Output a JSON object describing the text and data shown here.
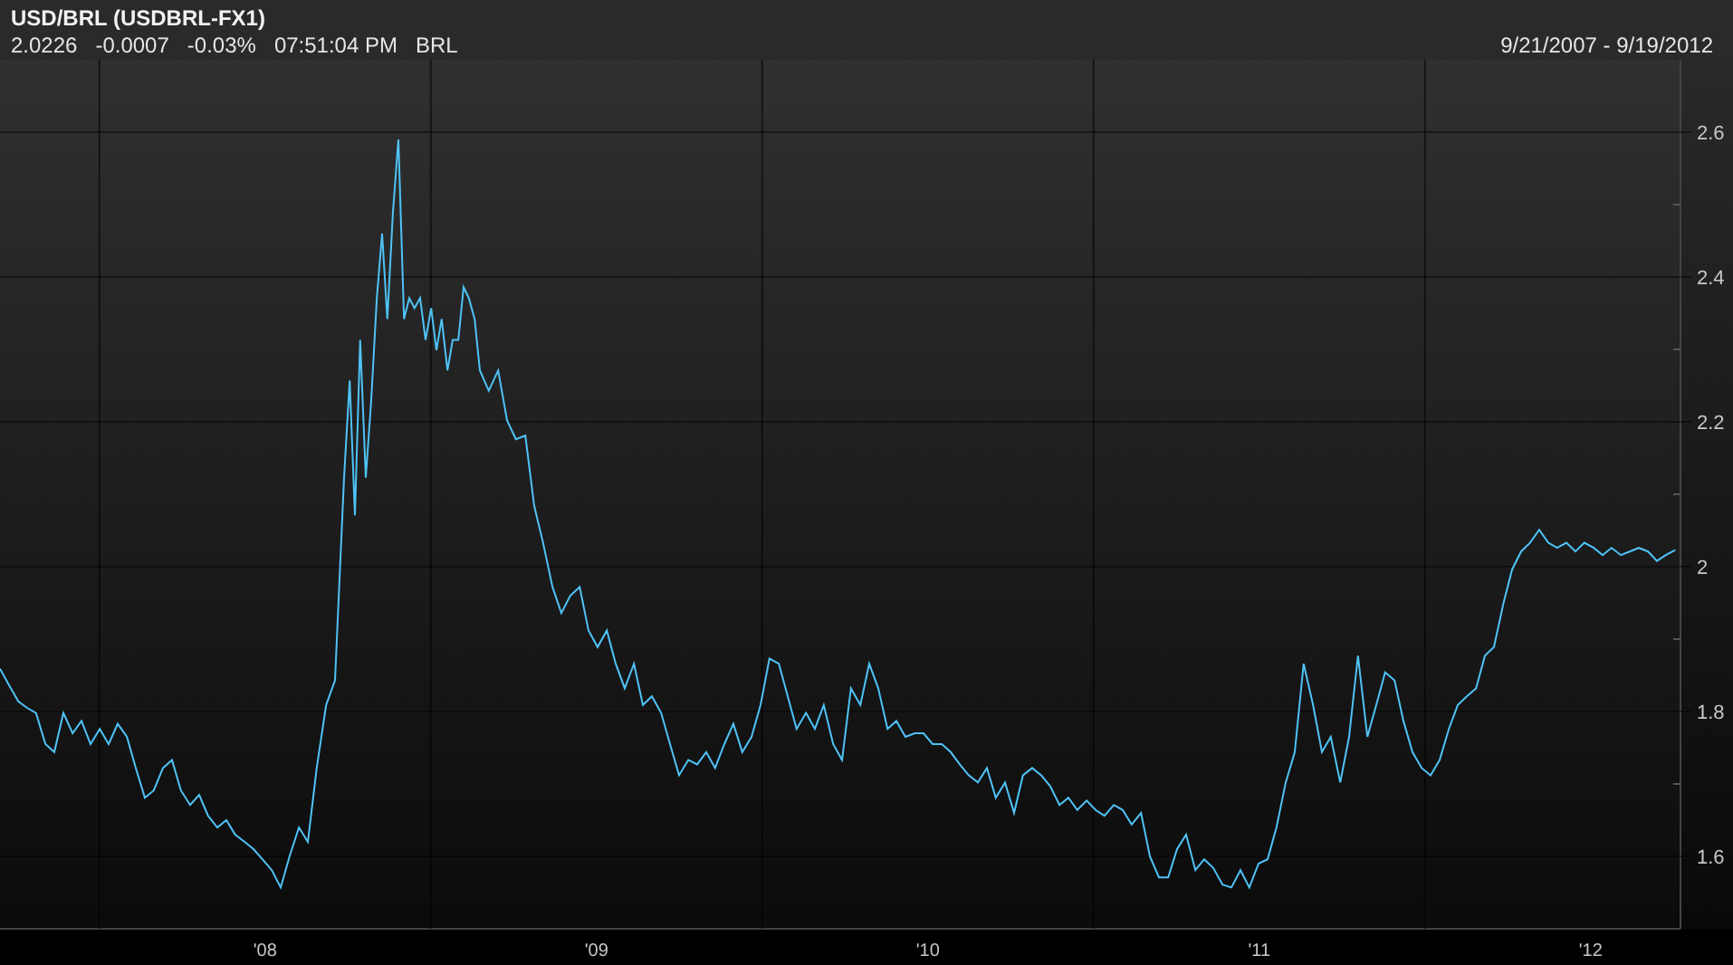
{
  "header": {
    "title": "USD/BRL (USDBRL-FX1)",
    "quote": {
      "price": "2.0226",
      "change": "-0.0007",
      "change_percent": "-0.03%",
      "time": "07:51:04 PM",
      "currency": "BRL"
    },
    "date_range": "9/21/2007 - 9/19/2012"
  },
  "chart": {
    "chart_data": {
      "type": "line",
      "x": [
        7.2,
        7.227,
        7.255,
        7.282,
        7.309,
        7.337,
        7.364,
        7.391,
        7.419,
        7.446,
        7.473,
        7.501,
        7.528,
        7.555,
        7.583,
        7.61,
        7.637,
        7.664,
        7.692,
        7.719,
        7.746,
        7.774,
        7.801,
        7.828,
        7.856,
        7.883,
        7.91,
        7.938,
        7.965,
        7.992,
        8.02,
        8.047,
        8.074,
        8.102,
        8.129,
        8.156,
        8.184,
        8.211,
        8.238,
        8.255,
        8.271,
        8.287,
        8.304,
        8.32,
        8.337,
        8.353,
        8.369,
        8.386,
        8.402,
        8.419,
        8.435,
        8.451,
        8.468,
        8.484,
        8.501,
        8.517,
        8.533,
        8.55,
        8.566,
        8.583,
        8.599,
        8.615,
        8.632,
        8.648,
        8.675,
        8.703,
        8.73,
        8.757,
        8.785,
        8.812,
        8.839,
        8.867,
        8.894,
        8.921,
        8.949,
        8.976,
        9.003,
        9.031,
        9.058,
        9.085,
        9.113,
        9.14,
        9.167,
        9.195,
        9.222,
        9.249,
        9.277,
        9.304,
        9.331,
        9.358,
        9.386,
        9.413,
        9.44,
        9.468,
        9.495,
        9.522,
        9.55,
        9.577,
        9.604,
        9.632,
        9.659,
        9.686,
        9.714,
        9.741,
        9.768,
        9.796,
        9.823,
        9.85,
        9.878,
        9.905,
        9.932,
        9.96,
        9.987,
        10.014,
        10.042,
        10.069,
        10.096,
        10.123,
        10.151,
        10.178,
        10.205,
        10.233,
        10.26,
        10.287,
        10.315,
        10.342,
        10.369,
        10.397,
        10.424,
        10.451,
        10.479,
        10.506,
        10.533,
        10.561,
        10.588,
        10.615,
        10.643,
        10.67,
        10.697,
        10.725,
        10.752,
        10.779,
        10.807,
        10.834,
        10.861,
        10.889,
        10.916,
        10.943,
        10.97,
        10.998,
        11.025,
        11.052,
        11.08,
        11.107,
        11.134,
        11.162,
        11.189,
        11.216,
        11.244,
        11.271,
        11.298,
        11.326,
        11.353,
        11.38,
        11.408,
        11.435,
        11.462,
        11.49,
        11.517,
        11.544,
        11.572,
        11.599,
        11.626,
        11.654,
        11.681,
        11.708,
        11.736,
        11.763,
        11.79,
        11.817,
        11.845,
        11.872,
        11.899,
        11.927,
        11.954,
        11.981,
        12.009,
        12.036,
        12.063,
        12.091,
        12.118,
        12.145,
        12.173,
        12.2,
        12.227,
        12.255
      ],
      "series": [
        {
          "color": "#4fc3f7",
          "values": [
            1.859,
            1.837,
            1.814,
            1.805,
            1.798,
            1.755,
            1.744,
            1.798,
            1.77,
            1.787,
            1.755,
            1.776,
            1.755,
            1.783,
            1.765,
            1.722,
            1.681,
            1.691,
            1.722,
            1.733,
            1.691,
            1.671,
            1.685,
            1.656,
            1.64,
            1.65,
            1.63,
            1.62,
            1.61,
            1.596,
            1.581,
            1.557,
            1.6,
            1.64,
            1.62,
            1.722,
            1.809,
            1.843,
            2.123,
            2.257,
            2.071,
            2.313,
            2.123,
            2.23,
            2.371,
            2.46,
            2.342,
            2.49,
            2.59,
            2.342,
            2.371,
            2.357,
            2.371,
            2.313,
            2.357,
            2.299,
            2.342,
            2.271,
            2.313,
            2.313,
            2.386,
            2.371,
            2.342,
            2.271,
            2.243,
            2.271,
            2.202,
            2.176,
            2.181,
            2.084,
            2.033,
            1.972,
            1.936,
            1.96,
            1.972,
            1.912,
            1.889,
            1.912,
            1.866,
            1.832,
            1.866,
            1.809,
            1.821,
            1.798,
            1.755,
            1.712,
            1.733,
            1.727,
            1.744,
            1.722,
            1.755,
            1.783,
            1.744,
            1.765,
            1.809,
            1.873,
            1.866,
            1.821,
            1.776,
            1.798,
            1.776,
            1.809,
            1.755,
            1.733,
            1.832,
            1.809,
            1.866,
            1.832,
            1.776,
            1.787,
            1.765,
            1.77,
            1.77,
            1.755,
            1.755,
            1.744,
            1.727,
            1.712,
            1.702,
            1.722,
            1.681,
            1.702,
            1.66,
            1.712,
            1.722,
            1.712,
            1.697,
            1.671,
            1.681,
            1.664,
            1.677,
            1.664,
            1.656,
            1.671,
            1.664,
            1.644,
            1.66,
            1.6,
            1.571,
            1.571,
            1.61,
            1.63,
            1.581,
            1.596,
            1.584,
            1.561,
            1.557,
            1.581,
            1.557,
            1.59,
            1.596,
            1.64,
            1.702,
            1.744,
            1.866,
            1.809,
            1.744,
            1.765,
            1.702,
            1.765,
            1.877,
            1.765,
            1.809,
            1.854,
            1.843,
            1.787,
            1.744,
            1.722,
            1.712,
            1.733,
            1.776,
            1.809,
            1.821,
            1.832,
            1.877,
            1.889,
            1.948,
            1.996,
            2.021,
            2.033,
            2.051,
            2.033,
            2.026,
            2.033,
            2.021,
            2.033,
            2.026,
            2.016,
            2.026,
            2.016,
            2.021,
            2.026,
            2.021,
            2.008,
            2.016,
            2.023
          ]
        }
      ],
      "xlim": [
        7.2,
        12.271
      ],
      "ylim": [
        1.5,
        2.7
      ],
      "grid": true,
      "xticks": [
        {
          "value": 8,
          "label": "'08"
        },
        {
          "value": 9,
          "label": "'09"
        },
        {
          "value": 10,
          "label": "'10"
        },
        {
          "value": 11,
          "label": "'11"
        },
        {
          "value": 12,
          "label": "'12"
        }
      ],
      "yticks": [
        {
          "value": 1.6,
          "label": "1.6"
        },
        {
          "value": 1.8,
          "label": "1.8"
        },
        {
          "value": 2,
          "label": "2"
        },
        {
          "value": 2.2,
          "label": "2.2"
        },
        {
          "value": 2.4,
          "label": "2.4"
        },
        {
          "value": 2.6,
          "label": "2.6"
        }
      ]
    }
  }
}
